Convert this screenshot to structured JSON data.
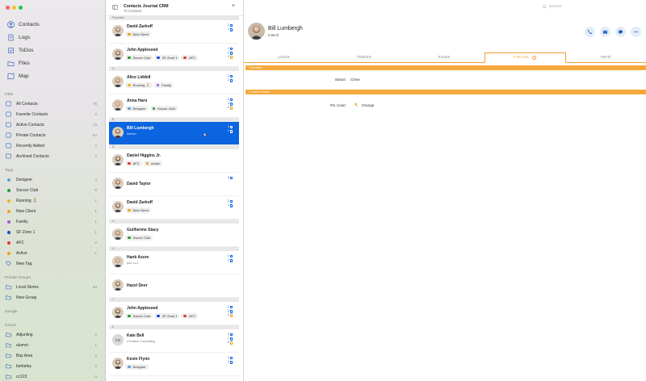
{
  "sidebar": {
    "nav": [
      {
        "label": "Contacts",
        "icon": "person-circle-icon"
      },
      {
        "label": "Logs",
        "icon": "document-icon"
      },
      {
        "label": "ToDos",
        "icon": "checklist-icon"
      },
      {
        "label": "Files",
        "icon": "folder-icon"
      },
      {
        "label": "Map",
        "icon": "map-icon"
      }
    ],
    "filter": {
      "heading": "Filter",
      "items": [
        {
          "label": "All Contacts",
          "count": "76"
        },
        {
          "label": "Favorite Contacts",
          "count": "2"
        },
        {
          "label": "Active Contacts",
          "count": "14"
        },
        {
          "label": "Private Contacts",
          "count": "64"
        },
        {
          "label": "Recently Added",
          "count": "2"
        },
        {
          "label": "Archived Contacts",
          "count": "2"
        }
      ]
    },
    "tags": {
      "heading": "Tags",
      "items": [
        {
          "label": "Designer",
          "count": "4",
          "color": "#5b9bd5"
        },
        {
          "label": "Soccer Club",
          "count": "8",
          "color": "#1e9a3a"
        },
        {
          "label": "Running 🏃",
          "count": "1",
          "color": "#f2b21a"
        },
        {
          "label": "New Client",
          "count": "1",
          "color": "#f2a21a"
        },
        {
          "label": "Family",
          "count": "1",
          "color": "#a259d9"
        },
        {
          "label": "SF Zone 1",
          "count": "1",
          "color": "#1446d6"
        },
        {
          "label": "AFC",
          "count": "2",
          "color": "#e0372c"
        },
        {
          "label": "Active",
          "count": "1",
          "color": "#f29a1a"
        },
        {
          "label": "New Tag",
          "count": "",
          "color": ""
        }
      ]
    },
    "private_groups": {
      "heading": "Private Groups",
      "items": [
        {
          "label": "Local Stores",
          "count": "53"
        },
        {
          "label": "New Group",
          "count": ""
        }
      ]
    },
    "google": {
      "heading": "Google"
    },
    "icloud": {
      "heading": "iCloud",
      "items": [
        {
          "label": "Adjunling",
          "count": "0"
        },
        {
          "label": "alumni",
          "count": "1"
        },
        {
          "label": "Bay Area",
          "count": "2"
        },
        {
          "label": "berkeley",
          "count": "0"
        },
        {
          "label": "cc123",
          "count": "0"
        }
      ]
    }
  },
  "list": {
    "title": "Contacts Journal CRM",
    "subtitle": "76 Contacts",
    "group_favorites": "Favorites",
    "contacts": [
      {
        "name": "David Zarkoff",
        "sub": "",
        "tags": [
          {
            "label": "New Client",
            "color": "#f2a21a"
          }
        ],
        "counts": [
          "2",
          "1"
        ],
        "initials": ""
      },
      {
        "name": "John Appleseed",
        "sub": "",
        "tags": [
          {
            "label": "Soccer Club",
            "color": "#1e9a3a"
          },
          {
            "label": "SF Zone 1",
            "color": "#1446d6"
          },
          {
            "label": "AFC",
            "color": "#e0372c"
          }
        ],
        "counts": [
          "1",
          "2",
          "2"
        ],
        "initials": ""
      },
      {
        "name": "Alice Liddell",
        "sub": "",
        "tags": [
          {
            "label": "Running 🏃",
            "color": "#f2b21a"
          },
          {
            "label": "Family",
            "color": "#a259d9"
          }
        ],
        "counts": [
          "1",
          "1"
        ],
        "initials": ""
      },
      {
        "name": "Anna Haro",
        "sub": "",
        "tags": [
          {
            "label": "Designer",
            "color": "#5b9bd5"
          },
          {
            "label": "Soccer Club",
            "color": "#1e9a3a"
          }
        ],
        "counts": [
          "1",
          "4",
          "2"
        ],
        "initials": ""
      },
      {
        "name": "Bill Lumbergh",
        "sub": "Initech",
        "tags": [],
        "counts": [
          "1",
          "1"
        ],
        "initials": ""
      },
      {
        "name": "Daniel Higgins Jr.",
        "sub": "",
        "tags": [
          {
            "label": "AFC",
            "color": "#e0372c"
          },
          {
            "label": "Active",
            "color": "#f29a1a"
          }
        ],
        "counts": [],
        "initials": ""
      },
      {
        "name": "David Taylor",
        "sub": "",
        "tags": [],
        "counts": [
          "4"
        ],
        "initials": ""
      },
      {
        "name": "David Zarkoff",
        "sub": "",
        "tags": [
          {
            "label": "New Client",
            "color": "#f2a21a"
          }
        ],
        "counts": [
          "2",
          "1"
        ],
        "initials": ""
      },
      {
        "name": "Guilherme Stacy",
        "sub": "",
        "tags": [
          {
            "label": "Soccer Club",
            "color": "#1e9a3a"
          }
        ],
        "counts": [],
        "initials": ""
      },
      {
        "name": "Hank Azure",
        "sub": "pan LLC",
        "tags": [],
        "counts": [
          "1",
          "1"
        ],
        "initials": ""
      },
      {
        "name": "Hazel Deer",
        "sub": "",
        "tags": [],
        "counts": [],
        "initials": ""
      },
      {
        "name": "John Appleseed",
        "sub": "",
        "tags": [
          {
            "label": "Soccer Club",
            "color": "#1e9a3a"
          },
          {
            "label": "SF Zone 1",
            "color": "#1446d6"
          },
          {
            "label": "AFC",
            "color": "#e0372c"
          }
        ],
        "counts": [
          "1",
          "2",
          "2"
        ],
        "initials": ""
      },
      {
        "name": "Kate Bell",
        "sub": "Creative Consulting",
        "tags": [],
        "counts": [
          "1",
          "1",
          "2"
        ],
        "initials": "KB"
      },
      {
        "name": "Kevin Flynn",
        "sub": "",
        "tags": [
          {
            "label": "Designer",
            "color": "#5b9bd5"
          }
        ],
        "counts": [
          "1",
          "1"
        ],
        "initials": ""
      }
    ],
    "section_letters": [
      "A",
      "B",
      "D",
      "G",
      "H",
      "J",
      "K"
    ]
  },
  "detail": {
    "search_placeholder": "Search",
    "name": "Bill Lumbergh",
    "company": "Initech",
    "actions": [
      {
        "name": "phone-icon"
      },
      {
        "name": "mail-icon"
      },
      {
        "name": "message-icon"
      },
      {
        "name": "more-icon"
      }
    ],
    "tabs": [
      "LOGS",
      "TODOS",
      "FILES",
      "FIELDS",
      "INFO"
    ],
    "active_tab": "FIELDS",
    "favorites_band": "Favorites",
    "custom_band": "Custom Fields",
    "status_label": "Status:",
    "status_value": "Close",
    "pin_label": "Pin Color:",
    "pin_value": "Orange"
  },
  "colors": {
    "accent": "#0b64e0",
    "orange": "#f5a93a"
  }
}
